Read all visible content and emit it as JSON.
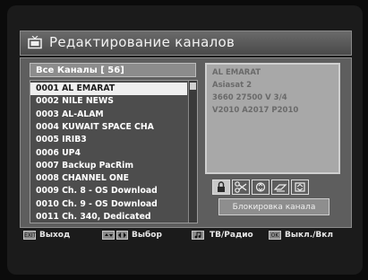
{
  "header": {
    "title": "Редактирование каналов"
  },
  "list": {
    "header": "Все Каналы [ 56]",
    "selected_index": 0,
    "channels": [
      "0001 AL EMARAT",
      "0002 NILE NEWS",
      "0003 AL-ALAM",
      "0004 KUWAIT SPACE CHA",
      "0005 IRIB3",
      "0006 UP4",
      "0007 Backup PacRim",
      "0008 CHANNEL ONE",
      "0009 Ch. 8 - OS Download",
      "0010 Ch. 9 - OS Download",
      "0011 Ch. 340, Dedicated"
    ]
  },
  "info": {
    "name": "AL EMARAT",
    "satellite": "Asiasat 2",
    "transponder": "3660 27500 V 3/4",
    "pids": "V2010 A2017 P2010"
  },
  "actions": {
    "buttons": [
      {
        "icon": "lock-icon",
        "active": true
      },
      {
        "icon": "scissors-icon",
        "active": false
      },
      {
        "icon": "move-icon",
        "active": false
      },
      {
        "icon": "rename-icon",
        "active": false
      },
      {
        "icon": "sort-icon",
        "active": false
      }
    ],
    "block_label": "Блокировка канала"
  },
  "footer": {
    "exit_key": "EXIT",
    "exit": "Выход",
    "select": "Выбор",
    "tvradio": "ТВ/Радио",
    "ok_key": "OK",
    "toggle": "Выкл./Вкл"
  },
  "colors": {
    "selected_row": "#efefef",
    "panel": "#5e5e5e"
  }
}
